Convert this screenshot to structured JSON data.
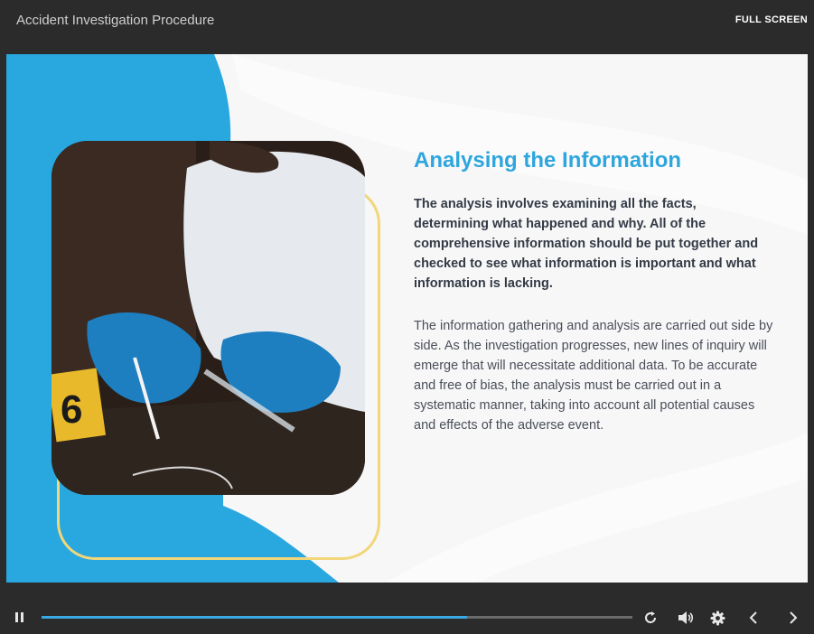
{
  "header": {
    "title": "Accident Investigation Procedure",
    "fullscreen_label": "FULL SCREEN"
  },
  "slide": {
    "heading": "Analysing the Information",
    "bold_paragraph": "The analysis involves examining all the facts, determining what happened and why. All of the comprehensive information should be put together and checked to see what information is important and what information is lacking.",
    "body_paragraph": "The information gathering and analysis are carried out side by side. As the investigation progresses, new lines of inquiry will emerge that will necessitate additional data. To be accurate and free of bias, the analysis must be carried out in a systematic manner, taking into account all potential causes and effects of the adverse event.",
    "photo_marker": "6"
  },
  "player": {
    "progress": 0.72,
    "icons": [
      "pause-icon",
      "replay-icon",
      "volume-icon",
      "settings-icon",
      "chevron-left-icon",
      "chevron-right-icon"
    ]
  },
  "colors": {
    "accent": "#2ea6dd",
    "blue_shape": "#29a8e0",
    "frame": "#f2d67a",
    "progress": "#3aa8e2",
    "chrome": "#2b2b2b"
  }
}
